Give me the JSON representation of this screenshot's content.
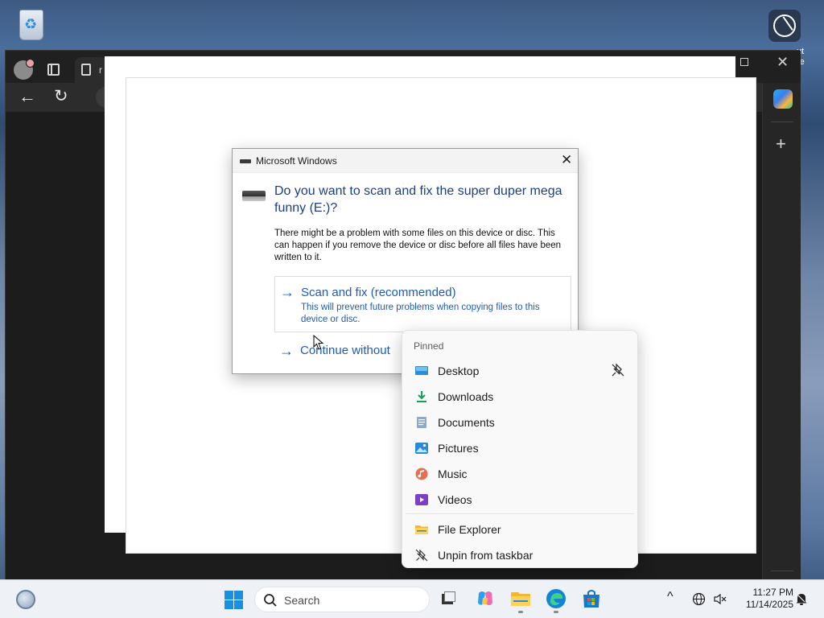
{
  "desktop": {
    "recycle_bin_icon": "recycle-bin-icon",
    "corner_app_label": "ut\nre"
  },
  "browser": {
    "tab_title": "r",
    "nav": {
      "back_icon": "←",
      "reload_icon": "↻",
      "close_icon": "✕",
      "new_icon": "+"
    }
  },
  "dialog": {
    "title": "Microsoft Windows",
    "close_glyph": "✕",
    "heading": "Do you want to scan and fix the super duper mega funny (E:)?",
    "body": "There might be a problem with some files on this device or disc. This can happen if you remove the device or disc before all files have been written to it.",
    "arrow_glyph": "→",
    "options": [
      {
        "title": "Scan and fix (recommended)",
        "description": "This will prevent future problems when copying files to this device or disc."
      },
      {
        "title": "Continue without",
        "description": ""
      }
    ]
  },
  "jumplist": {
    "section_label": "Pinned",
    "pinned": [
      {
        "label": "Desktop",
        "icon": "desktop-icon"
      },
      {
        "label": "Downloads",
        "icon": "downloads-icon"
      },
      {
        "label": "Documents",
        "icon": "documents-icon"
      },
      {
        "label": "Pictures",
        "icon": "pictures-icon"
      },
      {
        "label": "Music",
        "icon": "music-icon"
      },
      {
        "label": "Videos",
        "icon": "videos-icon"
      }
    ],
    "actions": [
      {
        "label": "File Explorer",
        "icon": "file-explorer-icon"
      },
      {
        "label": "Unpin from taskbar",
        "icon": "unpin-icon"
      }
    ]
  },
  "taskbar": {
    "search_placeholder": "Search",
    "time": "11:27 PM",
    "date": "11/14/2025",
    "chevron_glyph": "^",
    "apps": [
      "task-view-icon",
      "copilot-icon",
      "file-explorer-icon",
      "edge-icon",
      "store-icon"
    ]
  }
}
